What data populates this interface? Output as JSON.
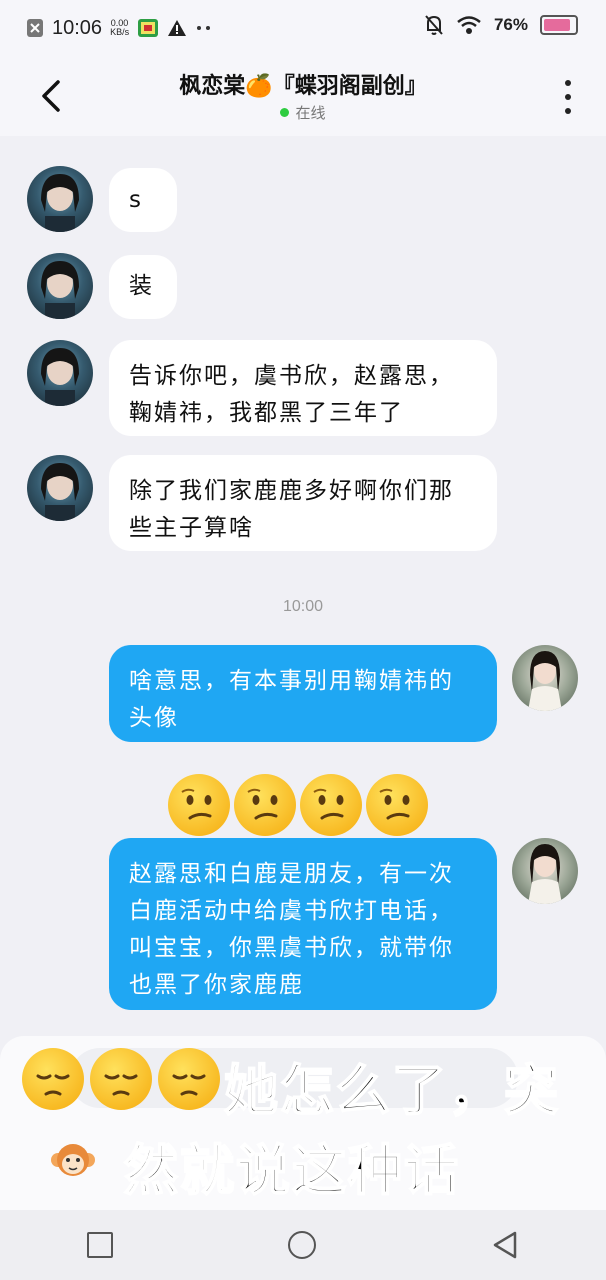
{
  "status_bar": {
    "time": "10:06",
    "net_speed": "0.00",
    "net_unit": "KB/s",
    "battery_text": "76%",
    "battery_level": 0.76,
    "icons": [
      "close-box-icon",
      "app-icon",
      "warning-icon",
      "more-dots-icon",
      "mute-bell-icon",
      "wifi-icon",
      "battery-icon"
    ]
  },
  "header": {
    "title": "枫恋棠🍊『蝶羽阁副创』",
    "status": "在线"
  },
  "messages": [
    {
      "side": "in",
      "text": "s"
    },
    {
      "side": "in",
      "text": "装"
    },
    {
      "side": "in",
      "text": "告诉你吧，虞书欣，赵露思，鞠婧祎，我都黑了三年了"
    },
    {
      "side": "in",
      "text": "除了我们家鹿鹿多好啊你们那些主子算啥"
    },
    {
      "side": "out",
      "text": "啥意思，有本事别用鞠婧祎的头像"
    },
    {
      "side": "out",
      "text": "赵露思和白鹿是朋友，有一次白鹿活动中给虞书欣打电话，叫宝宝，你黑虞书欣，就带你也黑了你家鹿鹿"
    }
  ],
  "timestamp": "10:00",
  "emoji_reaction": {
    "count": 4,
    "icon": "confused-face-emoji"
  },
  "subtitle": {
    "line1": "她怎么了，突",
    "line2": "然就说这种话",
    "emoji_icon": "pensive-face-emoji",
    "emoji_count": 3
  },
  "colors": {
    "outgoing_bubble": "#1fa7f3",
    "incoming_bubble": "#ffffff",
    "background": "#f0f0f5",
    "online_dot": "#2ecc40"
  }
}
